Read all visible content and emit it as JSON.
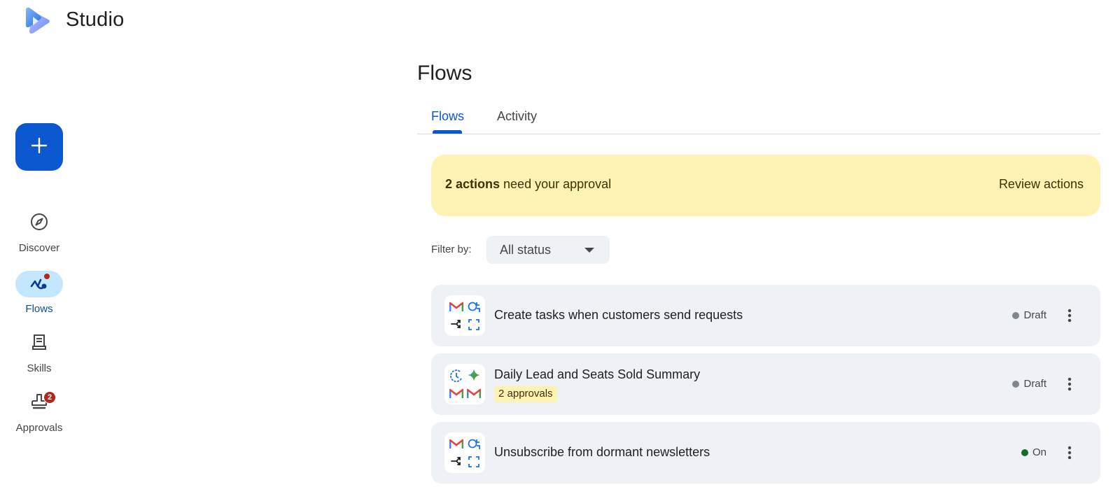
{
  "app": {
    "title": "Studio"
  },
  "sidebar": {
    "create_icon": "plus-icon",
    "items": [
      {
        "label": "Discover",
        "icon": "compass-icon",
        "active": false
      },
      {
        "label": "Flows",
        "icon": "flows-icon",
        "active": true
      },
      {
        "label": "Skills",
        "icon": "document-icon",
        "active": false
      },
      {
        "label": "Approvals",
        "icon": "stamp-icon",
        "active": false,
        "badge": "2"
      }
    ]
  },
  "main": {
    "title": "Flows",
    "tabs": [
      {
        "label": "Flows",
        "active": true
      },
      {
        "label": "Activity",
        "active": false
      }
    ],
    "banner": {
      "count_text": "2 actions",
      "rest_text": " need your approval",
      "action_label": "Review actions"
    },
    "filter": {
      "label": "Filter by:",
      "selected": "All status"
    },
    "flows": [
      {
        "name": "Create tasks when customers send requests",
        "status": "Draft",
        "status_color": "#80868b",
        "approvals": ""
      },
      {
        "name": "Daily Lead and Seats Sold Summary",
        "status": "Draft",
        "status_color": "#80868b",
        "approvals": "2 approvals"
      },
      {
        "name": "Unsubscribe from dormant newsletters",
        "status": "On",
        "status_color": "#146c2e",
        "approvals": ""
      }
    ]
  },
  "colors": {
    "accent": "#0b57d0",
    "banner_bg": "#fef3b4",
    "card_bg": "#eef1f6",
    "badge": "#b3261e"
  }
}
